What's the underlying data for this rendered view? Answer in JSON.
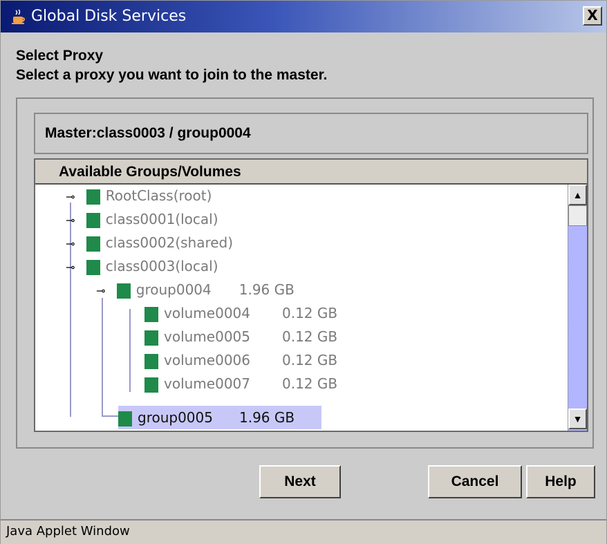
{
  "window": {
    "title": "Global Disk Services",
    "close_label": "X"
  },
  "heading": {
    "title": "Select Proxy",
    "subtitle": "Select a proxy you want to join to the master."
  },
  "master": {
    "label": "Master:class0003 / group0004"
  },
  "tree": {
    "column_header": "Available Groups/Volumes",
    "rows": [
      {
        "label": "RootClass(root)",
        "size": "",
        "icon": "root-class-icon",
        "toggle": "collapsed"
      },
      {
        "label": "class0001(local)",
        "size": "",
        "icon": "local-class-icon",
        "toggle": "collapsed"
      },
      {
        "label": "class0002(shared)",
        "size": "",
        "icon": "shared-class-icon",
        "toggle": "collapsed"
      },
      {
        "label": "class0003(local)",
        "size": "",
        "icon": "local-class-icon",
        "toggle": "expanded"
      },
      {
        "label": "group0004",
        "size": "1.96 GB",
        "icon": "group-icon",
        "toggle": "expanded"
      },
      {
        "label": "volume0004",
        "size": "0.12 GB",
        "icon": "volume-icon",
        "toggle": ""
      },
      {
        "label": "volume0005",
        "size": "0.12 GB",
        "icon": "volume-icon",
        "toggle": ""
      },
      {
        "label": "volume0006",
        "size": "0.12 GB",
        "icon": "volume-icon",
        "toggle": ""
      },
      {
        "label": "volume0007",
        "size": "0.12 GB",
        "icon": "volume-icon",
        "toggle": ""
      },
      {
        "label": "group0005",
        "size": "1.96 GB",
        "icon": "group-icon",
        "toggle": "",
        "selected": true
      }
    ]
  },
  "buttons": {
    "next": "Next",
    "cancel": "Cancel",
    "help": "Help"
  },
  "status_bar": {
    "text": "Java Applet Window"
  },
  "colors": {
    "title_start": "#0a1a72",
    "title_end": "#b8c6e8",
    "selection": "#c8c8f8",
    "icon_green": "#1f8a4a",
    "scroll_thumb": "#9aa0ff"
  }
}
